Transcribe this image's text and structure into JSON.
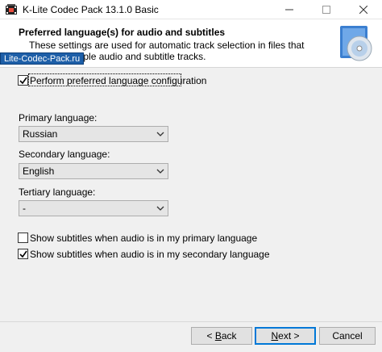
{
  "window": {
    "title": "K-Lite Codec Pack 13.1.0 Basic"
  },
  "header": {
    "title": "Preferred language(s) for audio and subtitles",
    "description": "These settings are used for automatic track selection in files that contain multiple audio and subtitle tracks.",
    "watermark": "Lite-Codec-Pack.ru"
  },
  "options": {
    "perform_config": {
      "label": "Perform preferred language configuration",
      "checked": true
    },
    "primary": {
      "label": "Primary language:",
      "value": "Russian"
    },
    "secondary": {
      "label": "Secondary language:",
      "value": "English"
    },
    "tertiary": {
      "label": "Tertiary language:",
      "value": "-"
    },
    "subs_primary": {
      "label": "Show subtitles when audio is in my primary language",
      "checked": false
    },
    "subs_secondary": {
      "label": "Show subtitles when audio is in my secondary language",
      "checked": true
    }
  },
  "buttons": {
    "back_accel": "B",
    "back_rest": "ack",
    "back_prefix": "< ",
    "next_accel": "N",
    "next_rest": "ext",
    "next_suffix": " >",
    "cancel": "Cancel"
  },
  "icons": {
    "app": "klite-app-icon",
    "header_image": "cd-disc-icon",
    "minimize": "minimize-icon",
    "maximize": "maximize-icon",
    "close": "close-icon",
    "dropdown": "chevron-down-icon",
    "check": "checkmark-icon"
  },
  "colors": {
    "accent": "#0078d7",
    "watermark_bg": "#1e5fa8"
  }
}
